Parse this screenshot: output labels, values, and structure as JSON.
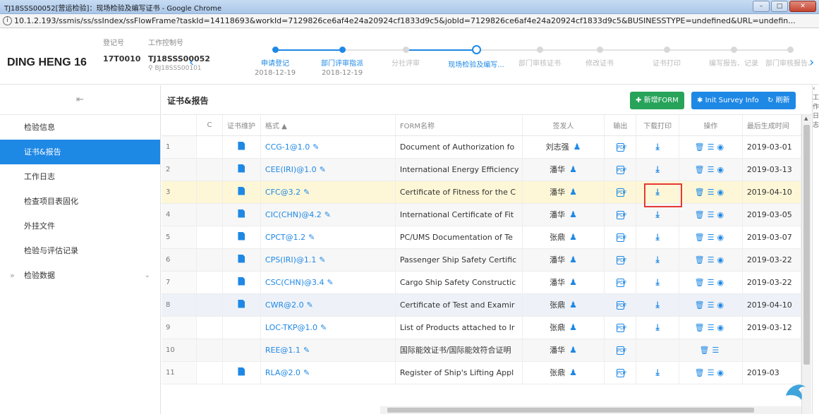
{
  "window": {
    "title": "TJ18SSS00052[营运检验]：现场检验及编写证书 - Google Chrome",
    "url": "10.1.2.193/ssmis/ss/ssIndex/ssFlowFrame?taskId=14118693&workId=7129826ce6af4e24a20924cf1833d9c5&jobId=7129826ce6af4e24a20924cf1833d9c5&BUSINESSTYPE=undefined&URL=undefin..."
  },
  "header": {
    "ship_name": "DING HENG 16",
    "reg_label": "登记号",
    "reg_value": "17T0010",
    "ctrl_label": "工作控制号",
    "ctrl_value": "TJ18SSS00052",
    "ctrl_sub": "BJ18SSS00101"
  },
  "steps": [
    {
      "label": "申请登记",
      "date": "2018-12-19",
      "state": "done"
    },
    {
      "label": "部门评审指派",
      "date": "2018-12-19",
      "state": "done"
    },
    {
      "label": "分社评审",
      "date": "",
      "state": "todo"
    },
    {
      "label": "现场检验及编写...",
      "date": "",
      "state": "current"
    },
    {
      "label": "部门审核证书",
      "date": "",
      "state": "todo"
    },
    {
      "label": "修改证书",
      "date": "",
      "state": "todo"
    },
    {
      "label": "证书打印",
      "date": "",
      "state": "todo"
    },
    {
      "label": "编写报告、记录",
      "date": "",
      "state": "todo"
    },
    {
      "label": "部门审核报告、",
      "date": "",
      "state": "todo"
    }
  ],
  "sidebar": {
    "items": [
      {
        "label": "检验信息",
        "active": false
      },
      {
        "label": "证书&报告",
        "active": true
      },
      {
        "label": "工作日志",
        "active": false
      },
      {
        "label": "检查项目表固化",
        "active": false
      },
      {
        "label": "外挂文件",
        "active": false
      },
      {
        "label": "检验与评估记录",
        "active": false
      },
      {
        "label": "检验数据",
        "active": false,
        "expandable": true
      }
    ]
  },
  "toolbar": {
    "title": "证书&报告",
    "add_form": "新增FORM",
    "init_survey": "Init Survey Info",
    "refresh": "刷新"
  },
  "table": {
    "columns": [
      "",
      "C",
      "证书维护",
      "格式 ▲",
      "FORM名称",
      "签发人",
      "输出",
      "下载打印",
      "操作",
      "最后生成时间"
    ],
    "rows": [
      {
        "idx": "1",
        "fmt": "CCG-1@1.0",
        "name": "Document of Authorization fo",
        "signer": "刘志强",
        "maint": true,
        "dl": true,
        "eye": true,
        "date": "2019-03-01"
      },
      {
        "idx": "2",
        "fmt": "CEE(IRI)@1.0",
        "name": "International Energy Efficiency",
        "signer": "潘华",
        "maint": true,
        "dl": true,
        "eye": true,
        "date": "2019-03-13"
      },
      {
        "idx": "3",
        "fmt": "CFC@3.2",
        "name": "Certificate of Fitness for the C",
        "signer": "潘华",
        "maint": true,
        "dl": true,
        "eye": true,
        "date": "2019-04-10"
      },
      {
        "idx": "4",
        "fmt": "CIC(CHN)@4.2",
        "name": "International Certificate of Fit",
        "signer": "潘华",
        "maint": true,
        "dl": true,
        "eye": true,
        "date": "2019-03-05"
      },
      {
        "idx": "5",
        "fmt": "CPCT@1.2",
        "name": "PC/UMS Documentation of Te",
        "signer": "张鼎",
        "maint": true,
        "dl": true,
        "eye": true,
        "date": "2019-03-07"
      },
      {
        "idx": "6",
        "fmt": "CPS(IRI)@1.1",
        "name": "Passenger Ship Safety Certific",
        "signer": "潘华",
        "maint": true,
        "dl": true,
        "eye": true,
        "date": "2019-03-22"
      },
      {
        "idx": "7",
        "fmt": "CSC(CHN)@3.4",
        "name": "Cargo Ship Safety Constructic",
        "signer": "潘华",
        "maint": true,
        "dl": true,
        "eye": true,
        "date": "2019-03-22"
      },
      {
        "idx": "8",
        "fmt": "CWR@2.0",
        "name": "Certificate of Test and Examir",
        "signer": "张鼎",
        "maint": true,
        "dl": true,
        "eye": true,
        "date": "2019-04-10"
      },
      {
        "idx": "9",
        "fmt": "LOC-TKP@1.0",
        "name": "List of Products attached to Ir",
        "signer": "张鼎",
        "maint": false,
        "dl": true,
        "eye": true,
        "date": "2019-03-12"
      },
      {
        "idx": "10",
        "fmt": "REE@1.1",
        "name": "国际能效证书/国际能效符合证明",
        "signer": "潘华",
        "maint": false,
        "dl": false,
        "eye": false,
        "date": ""
      },
      {
        "idx": "11",
        "fmt": "RLA@2.0",
        "name": "Register of Ship's Lifting Appl",
        "signer": "张鼎",
        "maint": true,
        "dl": true,
        "eye": true,
        "date": "2019-03"
      }
    ]
  },
  "icons": {
    "pen": "✎",
    "person": "♟",
    "dl": "⤓",
    "trash": "🗑",
    "list": "☰",
    "eye": "◉",
    "pdf": "PDF"
  },
  "colors": {
    "accent": "#1e88e5",
    "green": "#27a35a",
    "selected_row": "#fdf7d7",
    "highlight": "#e53935"
  }
}
